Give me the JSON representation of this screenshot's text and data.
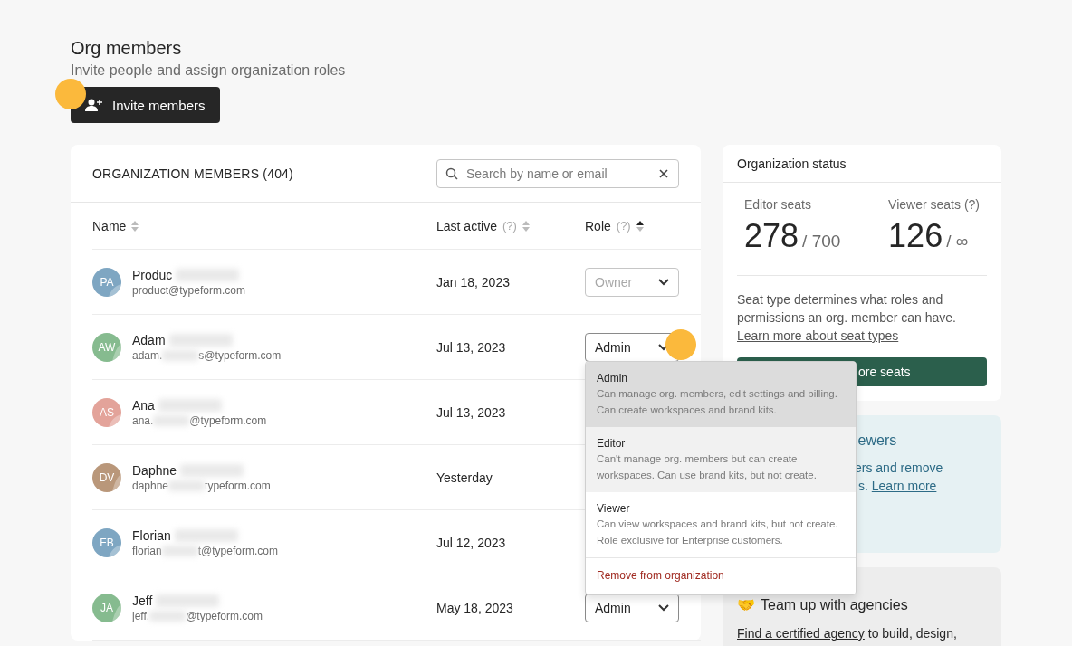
{
  "header": {
    "title": "Org members",
    "subtitle": "Invite people and assign organization roles",
    "invite_button": "Invite members"
  },
  "members_card": {
    "title": "ORGANIZATION MEMBERS (404)",
    "search": {
      "placeholder": "Search by name or email"
    },
    "columns": [
      {
        "label": "Name",
        "sorted": false
      },
      {
        "label": "Last active",
        "hint": "(?)",
        "sorted": false
      },
      {
        "label": "Role",
        "hint": "(?)",
        "sorted": true
      }
    ],
    "rows": [
      {
        "initials": "PA",
        "color": "#7ea6c2",
        "name": "Produc",
        "email": [
          "product@typeform.com"
        ],
        "last_active": "Jan 18, 2023",
        "role": {
          "value": "Owner",
          "disabled": true,
          "open": false
        }
      },
      {
        "initials": "AW",
        "color": "#86bb8f",
        "name": "Adam",
        "email": [
          "adam.",
          "s@typeform.com"
        ],
        "last_active": "Jul 13, 2023",
        "role": {
          "value": "Admin",
          "disabled": false,
          "open": true
        }
      },
      {
        "initials": "AS",
        "color": "#e3a39a",
        "name": "Ana",
        "email": [
          "ana.",
          "@typeform.com"
        ],
        "last_active": "Jul 13, 2023"
      },
      {
        "initials": "DV",
        "color": "#b9977a",
        "name": "Daphne",
        "email": [
          "daphne",
          "typeform.com"
        ],
        "last_active": "Yesterday"
      },
      {
        "initials": "FB",
        "color": "#7ea6c2",
        "name": "Florian",
        "email": [
          "florian",
          "t@typeform.com"
        ],
        "last_active": "Jul 12, 2023"
      },
      {
        "initials": "JA",
        "color": "#86bb8f",
        "name": "Jeff",
        "email": [
          "jeff.",
          "@typeform.com"
        ],
        "last_active": "May 18, 2023",
        "role": {
          "value": "Admin",
          "disabled": false,
          "open": false
        }
      }
    ],
    "role_menu": {
      "options": [
        {
          "label": "Admin",
          "description": "Can manage org. members, edit settings and billing. Can create workspaces and brand kits.",
          "selected": true,
          "hovered": false
        },
        {
          "label": "Editor",
          "description": "Can't manage org. members but can create workspaces. Can use brand kits, but not create.",
          "selected": false,
          "hovered": true
        },
        {
          "label": "Viewer",
          "description": "Can view workspaces and brand kits, but not create. Role exclusive for Enterprise customers.",
          "selected": false,
          "hovered": false
        }
      ],
      "remove": "Remove from organization"
    }
  },
  "status_card": {
    "title": "Organization status",
    "stats": [
      {
        "label": "Editor seats",
        "value": "278",
        "limit": "/ 700"
      },
      {
        "label": "Viewer seats (?)",
        "value": "126",
        "limit": "/ ∞"
      }
    ],
    "note": "Seat type determines what roles and permissions an org. member can have.",
    "note_link": "Learn more about seat types",
    "button": "ore seats"
  },
  "viewers_card": {
    "title": "iewers",
    "lines": [
      "ers and remove",
      "s. "
    ],
    "link": "Learn more"
  },
  "agencies_card": {
    "icon": "🤝",
    "title": "Team up with agencies",
    "link": "Find a certified agency",
    "text": " to build, design,"
  }
}
